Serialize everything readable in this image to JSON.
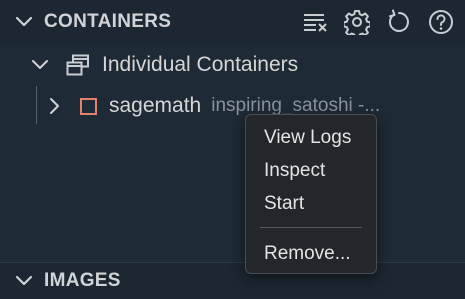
{
  "containers_section": {
    "title": "CONTAINERS",
    "actions": [
      "clear-filter-icon",
      "gear-icon",
      "refresh-icon",
      "help-icon"
    ]
  },
  "tree": {
    "group": {
      "label": "Individual Containers",
      "icon": "window-stack-icon"
    },
    "item": {
      "label": "sagemath",
      "description": "inspiring_satoshi -...",
      "status_color": "#e0826e"
    }
  },
  "context_menu": {
    "items": [
      "View Logs",
      "Inspect",
      "Start"
    ],
    "danger_item": "Remove..."
  },
  "images_section": {
    "title": "IMAGES"
  }
}
